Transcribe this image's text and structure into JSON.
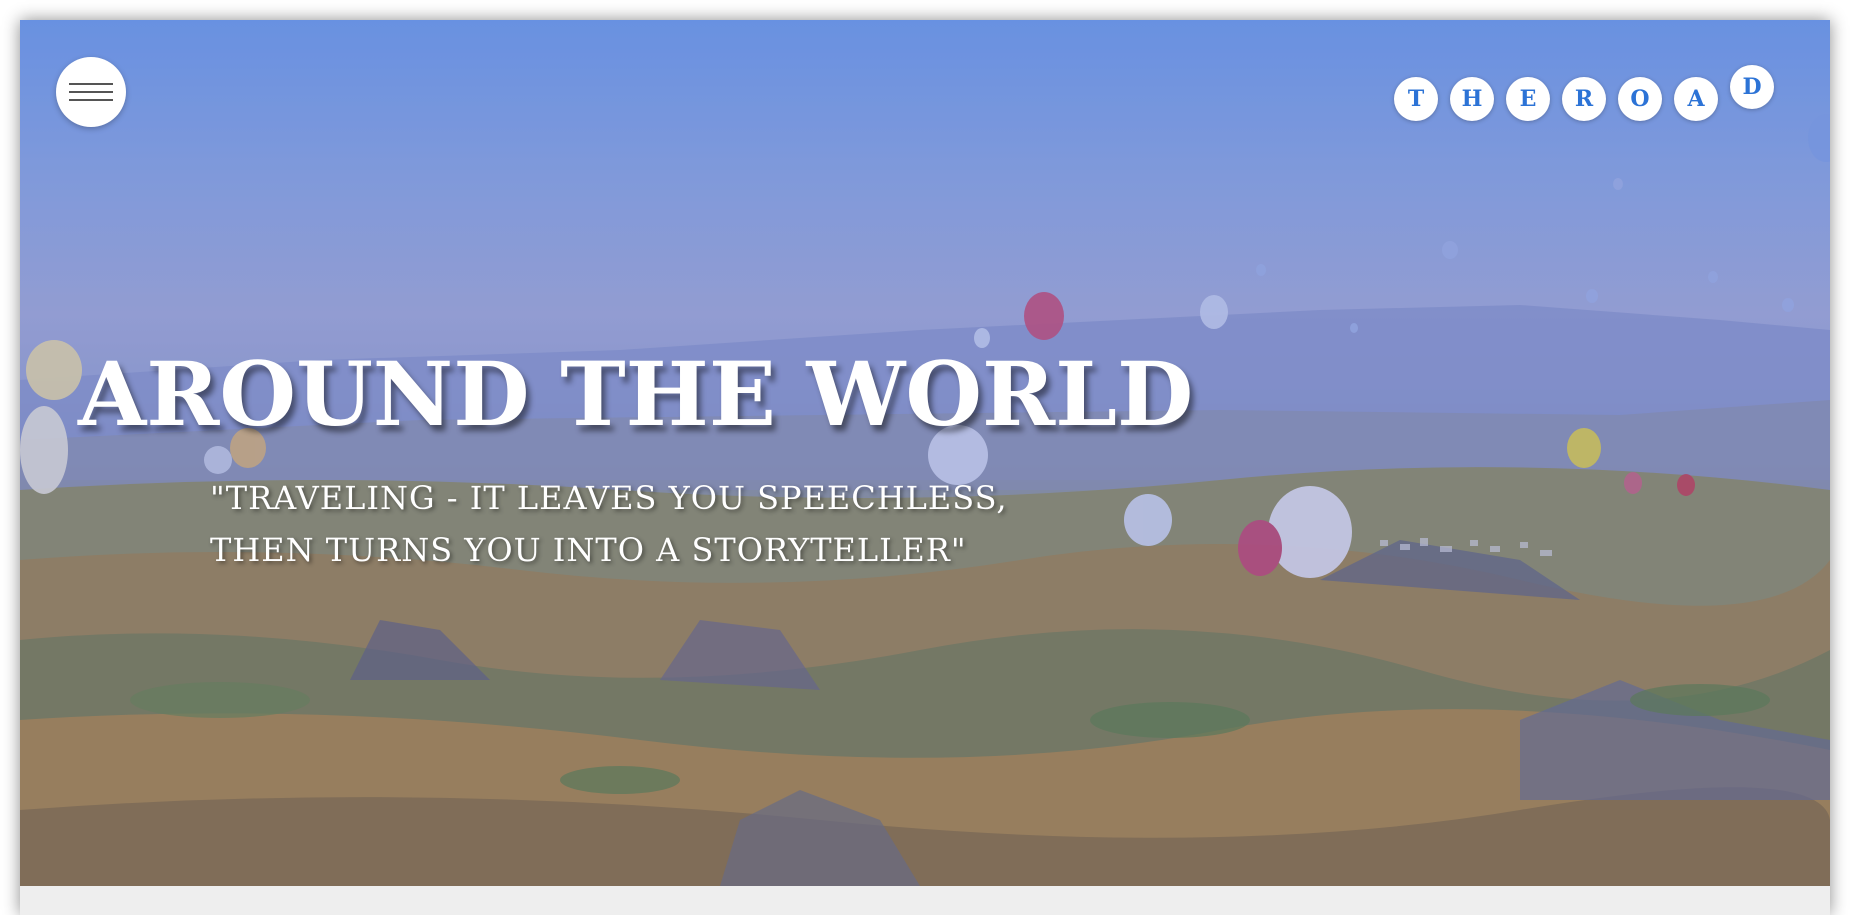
{
  "menu": {
    "icon": "hamburger-menu-icon"
  },
  "logo": {
    "letters": [
      "T",
      "H",
      "E",
      "R",
      "O",
      "A",
      "D"
    ]
  },
  "hero": {
    "title": "AROUND THE WORLD",
    "quote_line1": "\"TRAVELING - IT LEAVES YOU SPEECHLESS,",
    "quote_line2": "THEN TURNS YOU INTO A STORYTELLER\""
  },
  "colors": {
    "accent": "#2c73d6",
    "text": "#ffffff",
    "sky": "#6e9ae6"
  }
}
